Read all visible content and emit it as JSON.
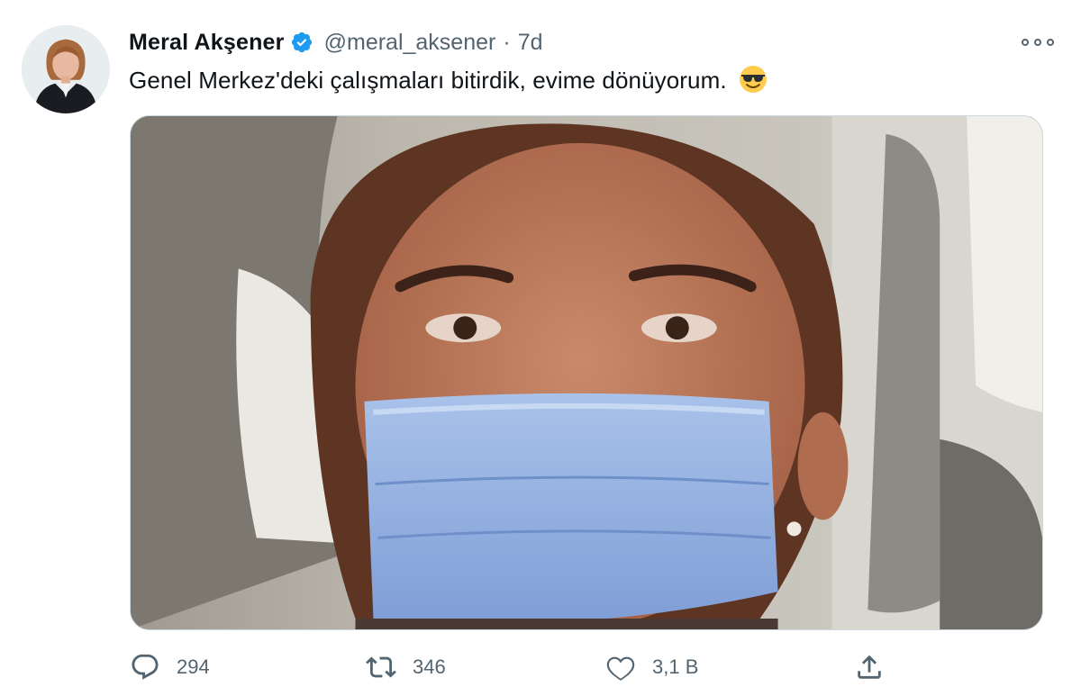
{
  "tweet": {
    "author": {
      "display_name": "Meral Akşener",
      "handle": "@meral_aksener",
      "verified": true,
      "avatar_icon": "profile-photo"
    },
    "separator": "·",
    "time": "7d",
    "text": "Genel Merkez'deki çalışmaları bitirdik, evime dönüyorum.",
    "emoji": "smiling-face-with-sunglasses",
    "media": {
      "kind": "photo",
      "subject": "selfie-in-car-with-blue-surgical-mask"
    },
    "actions": {
      "reply": {
        "icon": "reply-icon",
        "count": "294"
      },
      "retweet": {
        "icon": "retweet-icon",
        "count": "346"
      },
      "like": {
        "icon": "heart-icon",
        "count": "3,1 B"
      },
      "share": {
        "icon": "share-icon"
      }
    },
    "colors": {
      "verified_blue": "#1d9bf0",
      "text_primary": "#0f1419",
      "text_secondary": "#536471"
    }
  }
}
